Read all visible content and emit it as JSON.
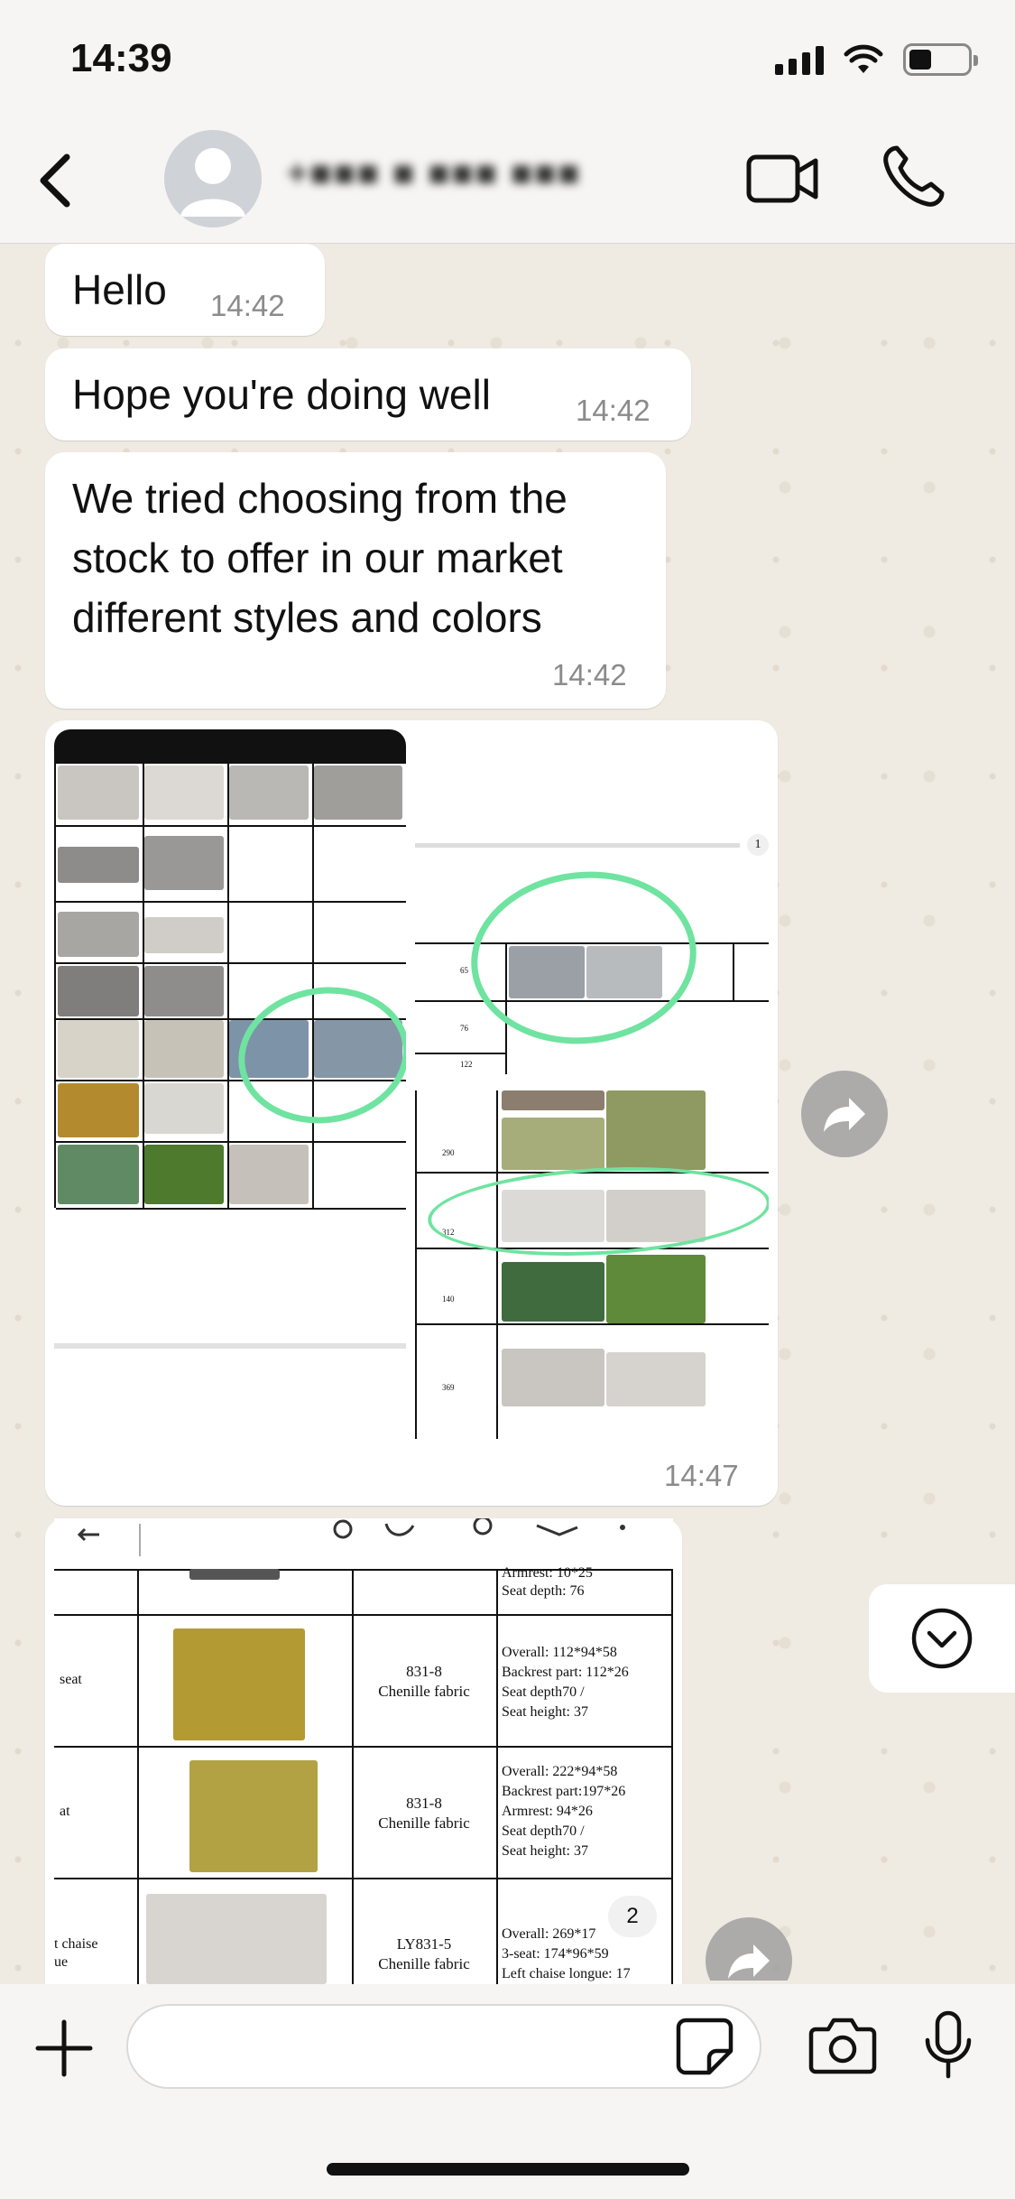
{
  "status_bar": {
    "time": "14:39"
  },
  "header": {
    "contact_name": "+■■■ ■ ■■■ ■■■"
  },
  "messages": [
    {
      "text": "Hello",
      "time": "14:42"
    },
    {
      "text": "Hope you're doing well",
      "time": "14:42"
    },
    {
      "text": "We tried choosing from the stock to offer in our market different styles and colors",
      "time": "14:42"
    }
  ],
  "media_group": {
    "time": "14:47",
    "right_top_page": "1",
    "right_top_row_labels": [
      "65",
      "76",
      "122"
    ],
    "right_bottom_row_labels": [
      "290",
      "312",
      "140",
      "369"
    ]
  },
  "document_preview": {
    "page_badge": "2",
    "top_spec": [
      "Armrest: 10*25",
      "Seat depth: 76"
    ],
    "rows": [
      {
        "name": "seat",
        "model": "831-8",
        "fabric": "Chenille fabric",
        "specs": [
          "Overall: 112*94*58",
          "Backrest part: 112*26",
          "Seat depth70 /",
          "Seat height: 37"
        ]
      },
      {
        "name": "at",
        "model": "831-8",
        "fabric": "Chenille fabric",
        "specs": [
          "Overall: 222*94*58",
          "Backrest part:197*26",
          "Armrest: 94*26",
          "Seat depth70 /",
          "Seat height: 37"
        ]
      },
      {
        "name": "t chaise\nue",
        "model": "LY831-5",
        "fabric": "Chenille fabric",
        "specs": [
          "Overall: 269*17",
          "3-seat: 174*96*59",
          "Left chaise longue: 17"
        ]
      }
    ]
  },
  "composer": {
    "placeholder": ""
  },
  "colors": {
    "bubble": "#ffffff",
    "wallpaper": "#efeae2",
    "circle": "#6fe3a0"
  }
}
